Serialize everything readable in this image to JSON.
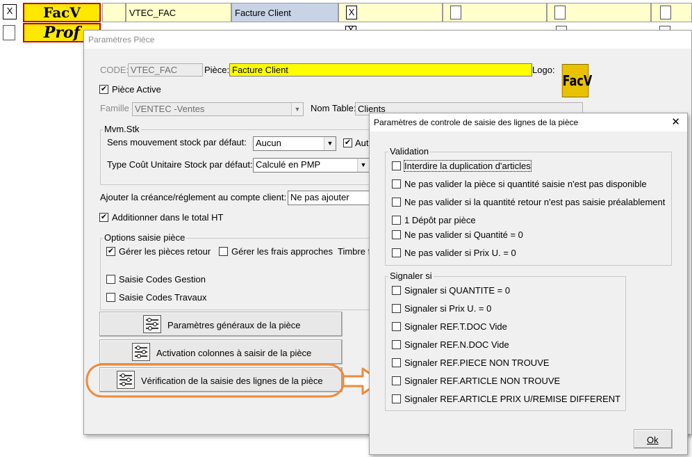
{
  "grid": {
    "row1": {
      "cell1_check": "X",
      "logo_label": "FacV",
      "code": "VTEC_FAC",
      "name": "Facture Client",
      "check2": "X"
    },
    "row2": {
      "logo_label": "Prof",
      "check2": "X"
    }
  },
  "piece_window": {
    "title": "Paramètres Pièce",
    "code_label": "CODE:",
    "code_value": "VTEC_FAC",
    "piece_label": "Pièce:",
    "piece_value": "Facture Client",
    "logo_label": "Logo:",
    "logo_image_text": "FacV",
    "active_label": "Pièce Active",
    "active_checked": "✔",
    "famille_label": "Famille",
    "famille_value": "VENTEC    -Ventes",
    "nomtable_label": "Nom Table:",
    "nomtable_value": "Clients",
    "mvm_group": "Mvm.Stk",
    "sens_label": "Sens mouvement stock par défaut:",
    "sens_value": "Aucun",
    "auto_label": "Auto",
    "auto_checked": "✔",
    "cout_label": "Type Coût Unitaire Stock par défaut:",
    "cout_value": "Calculé en PMP",
    "creance_label": "Ajouter la créance/réglement au compte client:",
    "creance_value": "Ne pas ajouter",
    "total_label": "Additionner dans le total HT",
    "total_checked": "✔",
    "options_group": "Options saisie pièce",
    "retour_label": "Gérer les pièces retour",
    "retour_checked": "✔",
    "frais_label": "Gérer les frais approches",
    "timbre_label": "Timbre f",
    "gestion_label": "Saisie Codes Gestion",
    "travaux_label": "Saisie Codes Travaux",
    "btn_general": "Paramètres généraux de la pièce",
    "btn_colonnes": "Activation colonnes à saisir de la pièce",
    "btn_verif": "Vérification  de la saisie des lignes de la pièce"
  },
  "dialog": {
    "title": "Paramètres de controle de saisie des lignes de la pièce",
    "close": "✕",
    "validation_group": "Validation",
    "validation_items": [
      "Interdire la duplication d'articles",
      "Ne pas valider la pièce si quantité saisie n'est pas disponible",
      "Ne pas valider si la quantité retour n'est pas saisie préalablement",
      "1 Dépôt par pièce",
      "Ne pas valider si Quantité = 0",
      "Ne pas valider si Prix U. = 0"
    ],
    "signaler_group": "Signaler si",
    "signaler_items": [
      "Signaler si QUANTITE = 0",
      "Signaler si Prix U. = 0",
      "Signaler REF.T.DOC Vide",
      "Signaler REF.N.DOC Vide",
      "Signaler REF.PIECE NON TROUVE",
      "Signaler REF.ARTICLE NON TROUVE",
      "Signaler REF.ARTICLE PRIX U/REMISE DIFFERENT"
    ],
    "ok_button": "Ok"
  },
  "colors": {
    "highlight_yellow": "#ffff00",
    "annotation_orange": "#ef8a3a",
    "logo_red": "#cc0000"
  }
}
